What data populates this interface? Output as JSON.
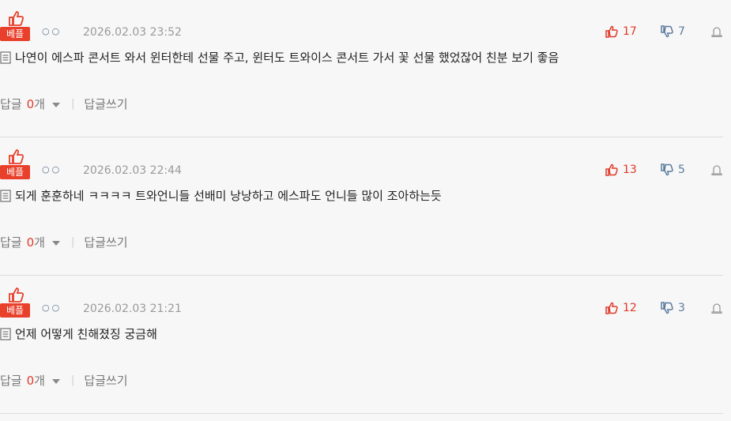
{
  "best_label": "베플",
  "user_dots": "○○",
  "comments": [
    {
      "timestamp": "2026.02.03 23:52",
      "likes": "17",
      "dislikes": "7",
      "text": "나연이 에스파 콘서트 와서 윈터한테 선물 주고, 윈터도 트와이스 콘서트 가서 꽃 선물 했었잖어 친분 보기 좋음",
      "reply_label": "답글",
      "reply_count": "0",
      "reply_unit": "개",
      "write_reply": "답글쓰기"
    },
    {
      "timestamp": "2026.02.03 22:44",
      "likes": "13",
      "dislikes": "5",
      "text": "되게 훈훈하네 ㅋㅋㅋㅋ 트와언니들 선배미 낭낭하고 에스파도 언니들 많이 조아하는듯",
      "reply_label": "답글",
      "reply_count": "0",
      "reply_unit": "개",
      "write_reply": "답글쓰기"
    },
    {
      "timestamp": "2026.02.03 21:21",
      "likes": "12",
      "dislikes": "3",
      "text": "언제 어떻게 친해졌징 궁금해",
      "reply_label": "답글",
      "reply_count": "0",
      "reply_unit": "개",
      "write_reply": "답글쓰기"
    }
  ],
  "colors": {
    "accent": "#e8402b",
    "dislike": "#5b7a9e"
  }
}
